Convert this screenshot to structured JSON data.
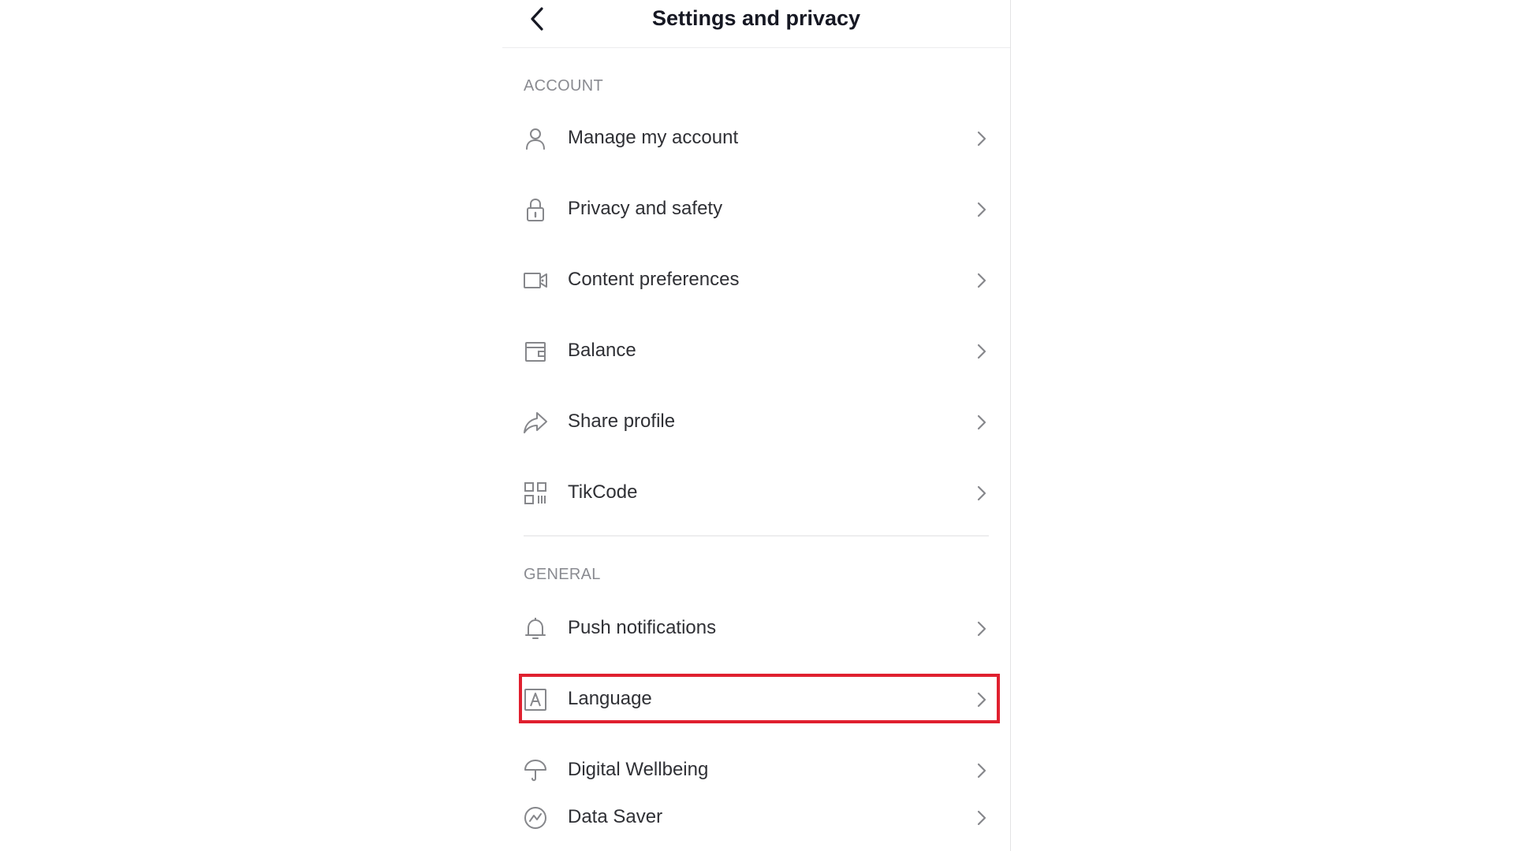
{
  "header": {
    "title": "Settings and privacy",
    "back_icon": "chevron-left-icon"
  },
  "sections": {
    "account": {
      "label": "ACCOUNT",
      "items": [
        {
          "label": "Manage my account",
          "icon": "person-icon"
        },
        {
          "label": "Privacy and safety",
          "icon": "lock-icon"
        },
        {
          "label": "Content preferences",
          "icon": "video-camera-icon"
        },
        {
          "label": "Balance",
          "icon": "wallet-icon"
        },
        {
          "label": "Share profile",
          "icon": "share-arrow-icon"
        },
        {
          "label": "TikCode",
          "icon": "qr-code-icon"
        }
      ]
    },
    "general": {
      "label": "GENERAL",
      "items": [
        {
          "label": "Push notifications",
          "icon": "bell-icon"
        },
        {
          "label": "Language",
          "icon": "language-a-icon",
          "highlighted": true
        },
        {
          "label": "Digital Wellbeing",
          "icon": "umbrella-icon"
        },
        {
          "label": "Data Saver",
          "icon": "data-saver-icon"
        }
      ]
    }
  },
  "colors": {
    "highlight": "#e0202f",
    "label_gray": "#8a8b91",
    "icon_gray": "#86878b",
    "text": "#161823"
  }
}
